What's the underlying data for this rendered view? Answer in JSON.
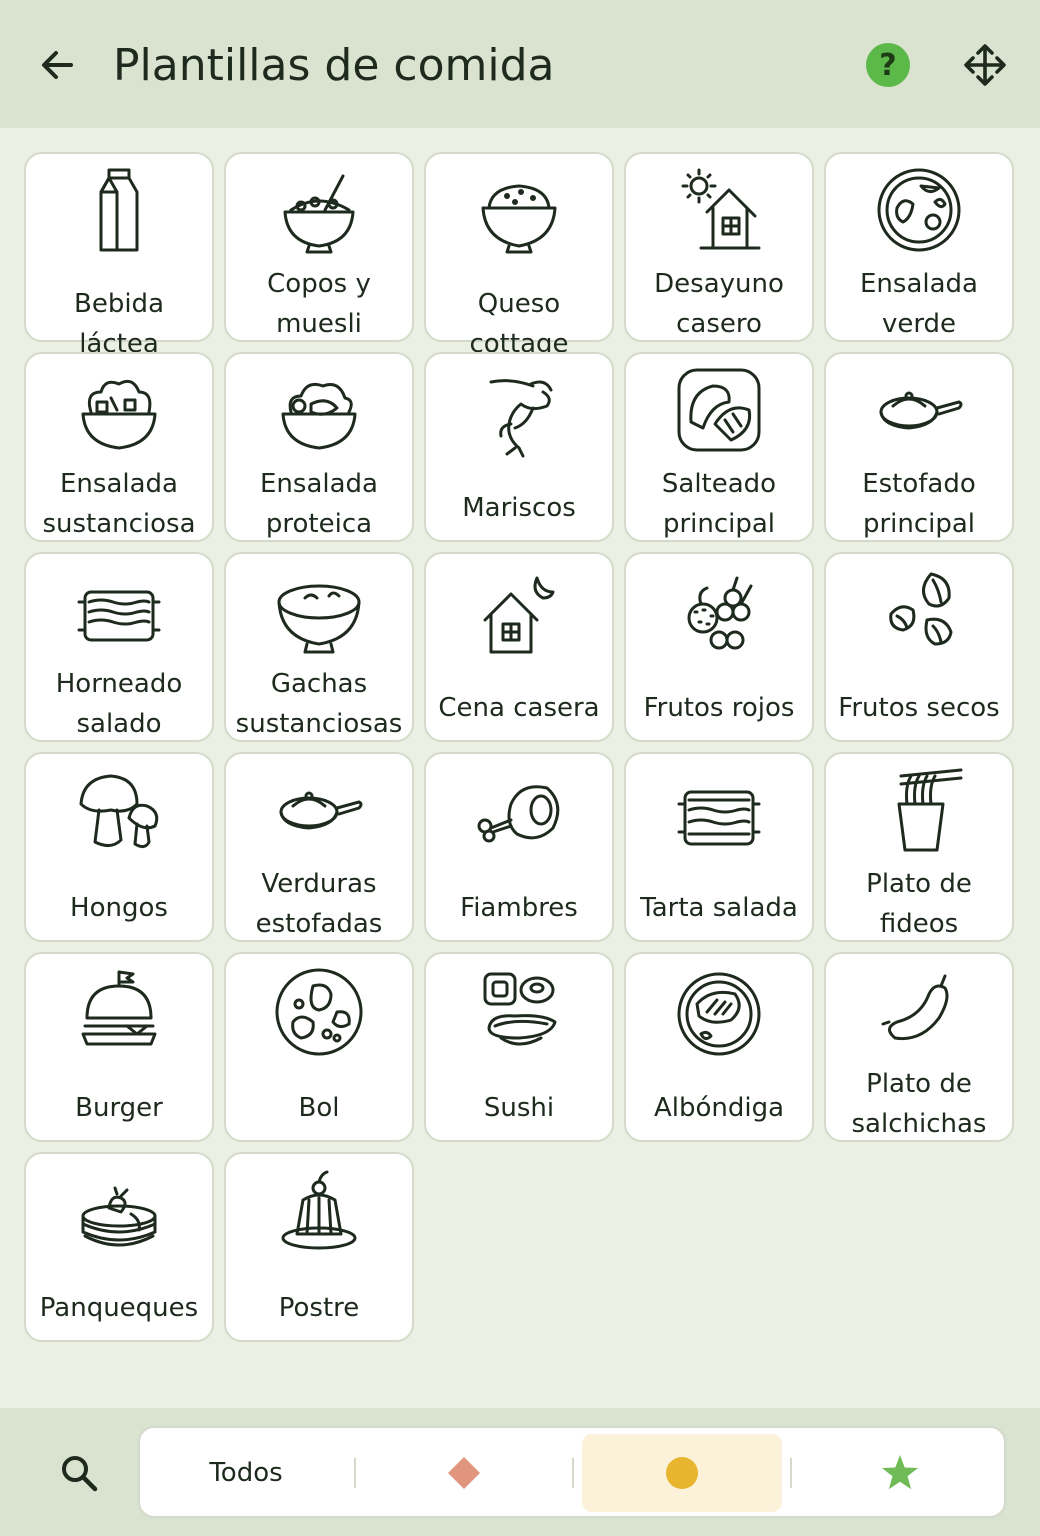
{
  "header": {
    "title": "Plantillas de comida"
  },
  "icons": {
    "back": "arrow-left-icon",
    "help": "question-mark-icon",
    "move": "move-arrows-icon",
    "search": "search-icon"
  },
  "colors": {
    "accent_green": "#5cb848",
    "diamond": "#e1957e",
    "circle": "#e8b62e",
    "star": "#6fbb55",
    "header_bg": "#dae3cf",
    "active_segment_bg": "#fcf1d9"
  },
  "help_symbol": "?",
  "templates": [
    {
      "label": "Bebida láctea",
      "icon": "milk-carton-icon"
    },
    {
      "label": "Copos y muesli",
      "icon": "cereal-bowl-icon"
    },
    {
      "label": "Queso cottage",
      "icon": "cottage-cheese-bowl-icon"
    },
    {
      "label": "Desayuno casero",
      "icon": "house-sun-icon"
    },
    {
      "label": "Ensalada verde",
      "icon": "salad-plate-icon"
    },
    {
      "label": "Ensalada sustanciosa",
      "icon": "hearty-salad-bowl-icon"
    },
    {
      "label": "Ensalada proteica",
      "icon": "protein-salad-bowl-icon"
    },
    {
      "label": "Mariscos",
      "icon": "shrimp-icon"
    },
    {
      "label": "Salteado principal",
      "icon": "fish-steak-icon"
    },
    {
      "label": "Estofado principal",
      "icon": "frying-pan-icon"
    },
    {
      "label": "Horneado salado",
      "icon": "lasagna-dish-icon"
    },
    {
      "label": "Gachas sustanciosas",
      "icon": "porridge-bowl-icon"
    },
    {
      "label": "Cena casera",
      "icon": "house-moon-icon"
    },
    {
      "label": "Frutos rojos",
      "icon": "berries-icon"
    },
    {
      "label": "Frutos secos",
      "icon": "nuts-icon"
    },
    {
      "label": "Hongos",
      "icon": "mushroom-icon"
    },
    {
      "label": "Verduras estofadas",
      "icon": "frying-pan-icon"
    },
    {
      "label": "Fiambres",
      "icon": "ham-leg-icon"
    },
    {
      "label": "Tarta salada",
      "icon": "casserole-dish-icon"
    },
    {
      "label": "Plato de fideos",
      "icon": "noodle-box-icon"
    },
    {
      "label": "Burger",
      "icon": "burger-icon"
    },
    {
      "label": "Bol",
      "icon": "bowl-plate-icon"
    },
    {
      "label": "Sushi",
      "icon": "sushi-icon"
    },
    {
      "label": "Albóndiga",
      "icon": "meat-plate-icon"
    },
    {
      "label": "Plato de salchichas",
      "icon": "sausage-icon"
    },
    {
      "label": "Panqueques",
      "icon": "pancakes-icon"
    },
    {
      "label": "Postre",
      "icon": "pudding-icon"
    }
  ],
  "filters": [
    {
      "label": "Todos",
      "icon": "",
      "selected": false
    },
    {
      "label": "",
      "icon": "diamond-icon",
      "selected": false
    },
    {
      "label": "",
      "icon": "circle-icon",
      "selected": true
    },
    {
      "label": "",
      "icon": "star-icon",
      "selected": false
    }
  ]
}
